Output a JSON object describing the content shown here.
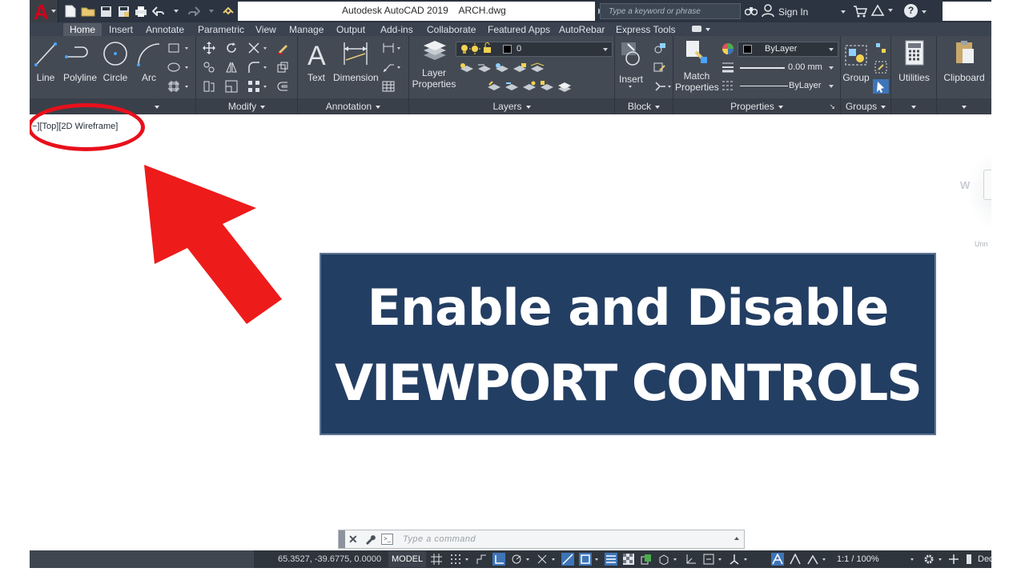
{
  "titlebar": {
    "app_name": "Autodesk AutoCAD 2019",
    "file_name": "ARCH.dwg",
    "search_placeholder": "Type a keyword or phrase",
    "signin_label": "Sign In",
    "help_glyph": "?"
  },
  "tabs": [
    {
      "label": "Home",
      "active": true
    },
    {
      "label": "Insert"
    },
    {
      "label": "Annotate"
    },
    {
      "label": "Parametric"
    },
    {
      "label": "View"
    },
    {
      "label": "Manage"
    },
    {
      "label": "Output"
    },
    {
      "label": "Add-ins"
    },
    {
      "label": "Collaborate"
    },
    {
      "label": "Featured Apps"
    },
    {
      "label": "AutoRebar"
    },
    {
      "label": "Express Tools"
    }
  ],
  "ribbon": {
    "draw": {
      "line": "Line",
      "polyline": "Polyline",
      "circle": "Circle",
      "arc": "Arc"
    },
    "modify": {
      "title": "Modify"
    },
    "annotation": {
      "title": "Annotation",
      "text": "Text",
      "dimension": "Dimension"
    },
    "layers": {
      "title": "Layers",
      "layer_properties_1": "Layer",
      "layer_properties_2": "Properties",
      "current_layer": "0"
    },
    "block": {
      "title": "Block",
      "insert": "Insert"
    },
    "properties": {
      "title": "Properties",
      "match_1": "Match",
      "match_2": "Properties",
      "color": "ByLayer",
      "lineweight": "0.00 mm",
      "linetype": "ByLayer"
    },
    "groups": {
      "title": "Groups",
      "group": "Group"
    },
    "utilities": {
      "label": "Utilities"
    },
    "clipboard": {
      "label": "Clipboard"
    }
  },
  "viewport": {
    "controls_label": "−][Top][2D Wireframe]",
    "compass_letter": "W",
    "wcs_label": "Unn"
  },
  "overlay": {
    "line1": "Enable and Disable",
    "line2": "VIEWPORT CONTROLS"
  },
  "command_line": {
    "placeholder": "Type  a  command"
  },
  "statusbar": {
    "coordinates": "65.3527, -39.6775, 0.0000",
    "model": "MODEL",
    "annotation_scale": "1:1 / 100%",
    "units": "Decima"
  },
  "colors": {
    "title_bar": "#2b3440",
    "ribbon": "#434a54",
    "highlight_red": "#e8101c",
    "overlay_bg": "#233e63",
    "status_active": "#3d75b8"
  }
}
